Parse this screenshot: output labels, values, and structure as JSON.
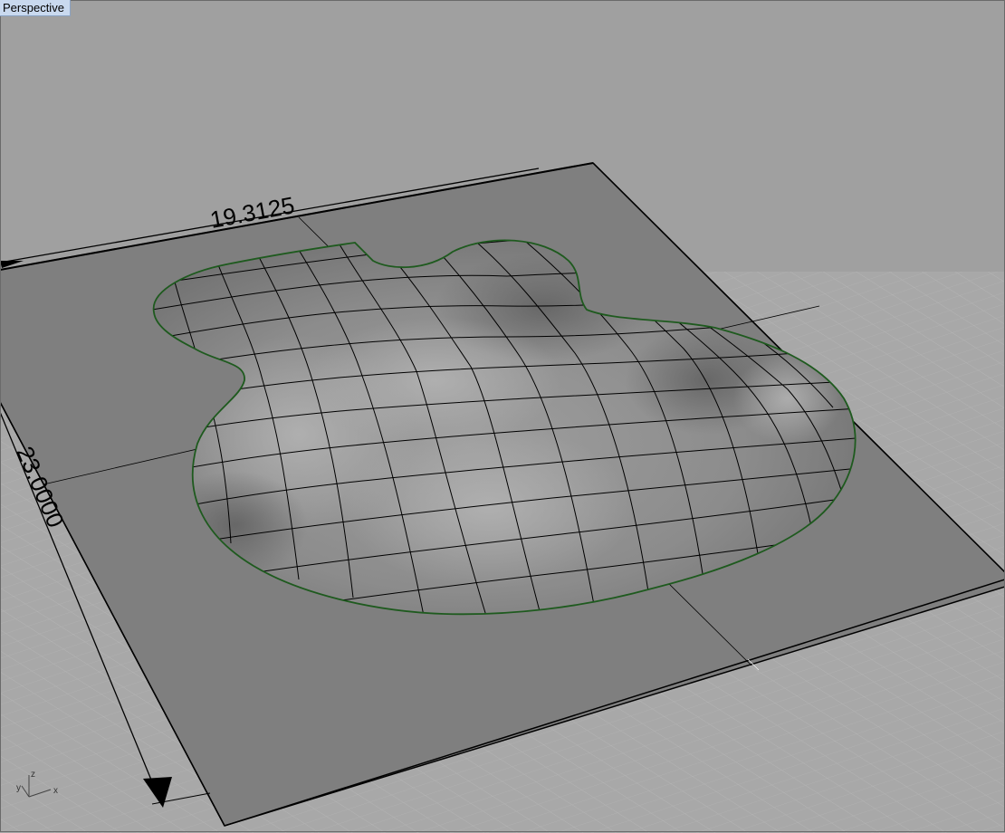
{
  "viewport": {
    "title": "Perspective",
    "background_color": "#a0a0a0",
    "tab_color": "#c9d9ef"
  },
  "dimensions": {
    "width_label": "19.3125",
    "height_label": "23.0000"
  },
  "axis_widget": {
    "z_label": "z",
    "y_label": "y",
    "x_label": "x"
  },
  "colors": {
    "plate": "#7f7f7f",
    "surface": "#959595",
    "edge_highlight": "#1e5a1e",
    "wire": "#000000"
  }
}
